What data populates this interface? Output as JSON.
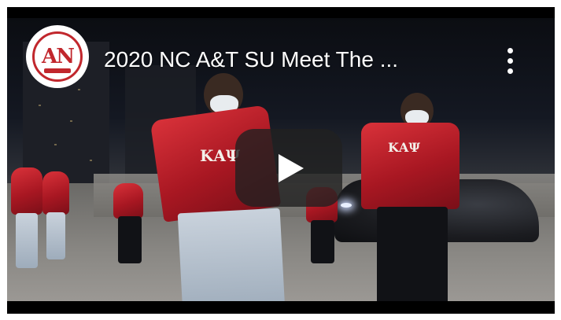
{
  "video": {
    "title": "2020 NC A&T SU Meet The ...",
    "channel_logo_letters": "AN",
    "play_icon": "play-icon",
    "menu_icon": "kebab-menu-icon"
  },
  "scene": {
    "jacket_letters_left": "ΚΑΨ",
    "jacket_letters_right": "ΚΑΨ"
  },
  "colors": {
    "brand_red": "#c1272d",
    "overlay": "#212121"
  }
}
